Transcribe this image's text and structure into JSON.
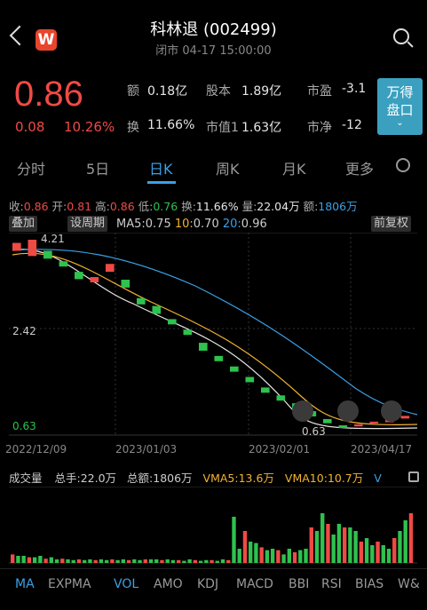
{
  "header": {
    "title": "科林退 (002499)",
    "subtitle": "闭市 04-17 15:00:00",
    "logo": "W"
  },
  "quote": {
    "price": "0.86",
    "change": "0.08",
    "change_pct": "10.26%",
    "stats": [
      {
        "label": "额",
        "value": "0.18亿"
      },
      {
        "label": "股本",
        "value": "1.89亿"
      },
      {
        "label": "市盈",
        "value": "-3.1"
      },
      {
        "label": "换",
        "value": "11.66%"
      },
      {
        "label": "市值1",
        "value": "1.63亿"
      },
      {
        "label": "市净",
        "value": "-12"
      }
    ],
    "wd_button": "万得\n盘口"
  },
  "tabs": [
    "分时",
    "5日",
    "日K",
    "周K",
    "月K",
    "更多"
  ],
  "active_tab": "日K",
  "info_bar": {
    "close_label": "收:",
    "close": "0.86",
    "open_label": "开:",
    "open": "0.81",
    "high_label": "高:",
    "high": "0.86",
    "low_label": "低:",
    "low": "0.76",
    "turnover_label": "换:",
    "turnover": "11.66%",
    "vol_label": "量:",
    "vol": "22.04万",
    "amt_label": "额:",
    "amt": "1806万"
  },
  "toolbar": {
    "overlay": "叠加",
    "set_period": "设周期",
    "adjust": "前复权"
  },
  "ma": {
    "ma5_label": "MA5:",
    "ma5": "0.75",
    "ma10_label": "10:",
    "ma10": "0.70",
    "ma20_label": "20:",
    "ma20": "0.96"
  },
  "chart_labels": {
    "y_top": "2.42",
    "y_bottom": "0.63",
    "max_label": "4.21",
    "min_label": "0.63",
    "x_ticks": [
      "2022/12/09",
      "2023/01/03",
      "2023/02/01",
      "2023/04/17"
    ]
  },
  "volume": {
    "title": "成交量",
    "total_hand": "总手:22.0万",
    "total_amt": "总额:1806万",
    "vma5": "VMA5:13.6万",
    "vma10": "VMA10:10.7万",
    "v": "V"
  },
  "indicators": [
    "MA",
    "EXPMA",
    "VOL",
    "AMO",
    "KDJ",
    "MACD",
    "BBI",
    "RSI",
    "BIAS",
    "W&"
  ],
  "colors": {
    "up": "#f04a45",
    "down": "#2ec24e",
    "ma5": "#e6e6e6",
    "ma10": "#f2b230",
    "ma20": "#3aa0e6",
    "accent": "#3aa0e6"
  },
  "chart_data": {
    "type": "candlestick",
    "price_range": [
      0.63,
      4.21
    ],
    "candles": [
      [
        4.0,
        4.15
      ],
      [
        3.9,
        4.21
      ],
      [
        4.0,
        3.85
      ],
      [
        3.8,
        3.7
      ],
      [
        3.6,
        3.46
      ],
      [
        3.4,
        3.5
      ],
      [
        3.6,
        3.75
      ],
      [
        3.45,
        3.3
      ],
      [
        3.1,
        2.98
      ],
      [
        2.95,
        2.8
      ],
      [
        2.7,
        2.6
      ],
      [
        2.5,
        2.4
      ],
      [
        2.25,
        2.1
      ],
      [
        2.0,
        1.9
      ],
      [
        1.8,
        1.7
      ],
      [
        1.6,
        1.5
      ],
      [
        1.4,
        1.3
      ],
      [
        1.25,
        1.15
      ],
      [
        1.1,
        1.0
      ],
      [
        0.95,
        0.85
      ],
      [
        0.8,
        0.72
      ],
      [
        0.68,
        0.63
      ],
      [
        0.66,
        0.7
      ],
      [
        0.72,
        0.75
      ],
      [
        0.74,
        0.8
      ],
      [
        0.81,
        0.86
      ]
    ]
  }
}
